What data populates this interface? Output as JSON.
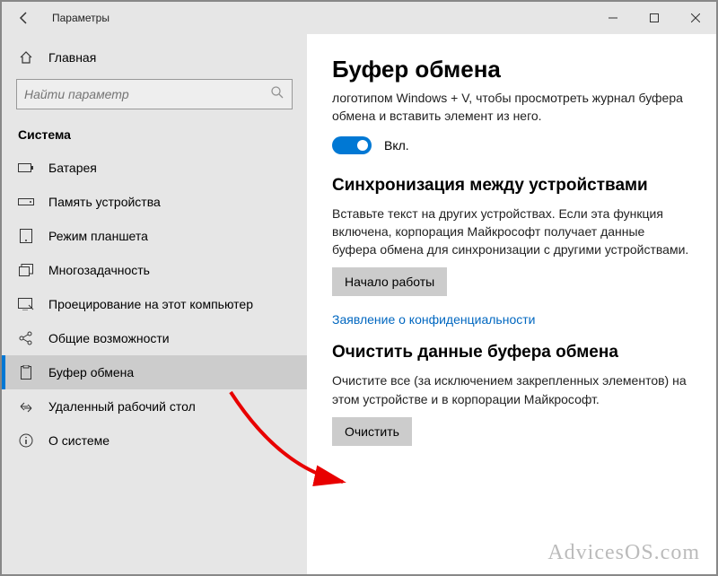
{
  "window": {
    "title": "Параметры"
  },
  "sidebar": {
    "home_label": "Главная",
    "search_placeholder": "Найти параметр",
    "section_label": "Система",
    "items": [
      {
        "label": "Батарея"
      },
      {
        "label": "Память устройства"
      },
      {
        "label": "Режим планшета"
      },
      {
        "label": "Многозадачность"
      },
      {
        "label": "Проецирование на этот компьютер"
      },
      {
        "label": "Общие возможности"
      },
      {
        "label": "Буфер обмена"
      },
      {
        "label": "Удаленный рабочий стол"
      },
      {
        "label": "О системе"
      }
    ]
  },
  "main": {
    "title": "Буфер обмена",
    "history_desc": "логотипом Windows + V, чтобы просмотреть журнал буфера обмена и вставить элемент из него.",
    "toggle_label": "Вкл.",
    "sync_heading": "Синхронизация между устройствами",
    "sync_desc": "Вставьте текст на других устройствах. Если эта функция включена, корпорация Майкрософт получает данные буфера обмена для синхронизации с другими устройствами.",
    "sync_button": "Начало работы",
    "privacy_link": "Заявление о конфиденциальности",
    "clear_heading": "Очистить данные буфера обмена",
    "clear_desc": "Очистите все (за исключением закрепленных элементов) на этом устройстве и в корпорации Майкрософт.",
    "clear_button": "Очистить"
  },
  "watermark": "AdvicesOS.com"
}
